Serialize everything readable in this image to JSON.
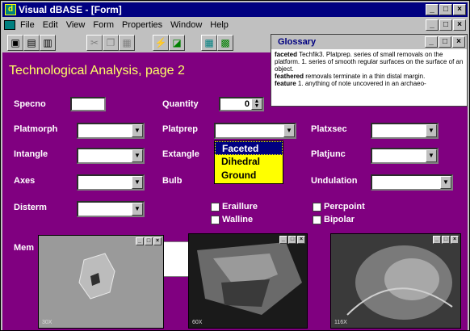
{
  "window": {
    "title": "Visual dBASE - [Form]",
    "controls": [
      "_",
      "□",
      "×"
    ]
  },
  "menu": {
    "items": [
      {
        "label": "File"
      },
      {
        "label": "Edit"
      },
      {
        "label": "View"
      },
      {
        "label": "Form"
      },
      {
        "label": "Properties"
      },
      {
        "label": "Window"
      },
      {
        "label": "Help"
      }
    ]
  },
  "toolbar": {
    "buttons": [
      "open-icon",
      "save-icon",
      "print-icon",
      "cut-icon",
      "copy-icon",
      "paste-icon",
      "run-icon",
      "design-icon",
      "table-icon",
      "form-icon"
    ]
  },
  "form": {
    "title": "Technological Analysis, page 2",
    "labels": {
      "specno": "Specno",
      "quantity": "Quantity",
      "platmorph": "Platmorph",
      "platprep": "Platprep",
      "platxsec": "Platxsec",
      "intangle": "Intangle",
      "extangle": "Extangle",
      "platjunc": "Platjunc",
      "axes": "Axes",
      "bulb": "Bulb",
      "undulation": "Undulation",
      "disterm": "Disterm",
      "memo": "Mem"
    },
    "quantity_value": "0",
    "dropdown_options": [
      "Faceted",
      "Dihedral",
      "Ground"
    ],
    "dropdown_selected": "Faceted",
    "checkboxes": {
      "eraillure": "Eraillure",
      "walline": "Walline",
      "percpoint": "Percpoint",
      "bipolar": "Bipolar"
    }
  },
  "glossary": {
    "title": "Glossary",
    "entries": [
      {
        "term": "faceted",
        "text": "Techfik3. Platprep. series of small removals on the platform. 1. series of smooth regular surfaces on the surface of an object."
      },
      {
        "term": "feathered",
        "text": "removals terminate in a thin distal margin."
      },
      {
        "term": "feature",
        "text": "1. anything of note uncovered in an archaeo-"
      }
    ]
  },
  "images": [
    {
      "magnification": "30X"
    },
    {
      "magnification": "60X"
    },
    {
      "magnification": "116X"
    }
  ]
}
